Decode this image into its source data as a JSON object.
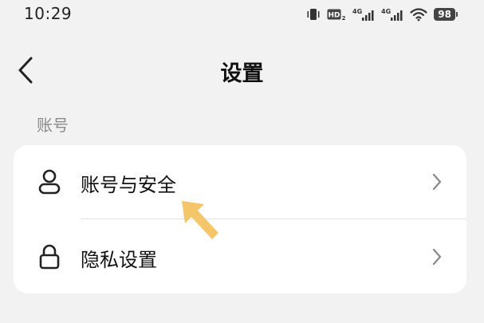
{
  "status_bar": {
    "time": "10:29",
    "battery": "98",
    "network_1": "4G",
    "network_2": "4G",
    "hd": "HD"
  },
  "header": {
    "title": "设置"
  },
  "section": {
    "label": "账号"
  },
  "settings": {
    "items": [
      {
        "label": "账号与安全",
        "icon": "user-icon"
      },
      {
        "label": "隐私设置",
        "icon": "lock-icon"
      }
    ]
  },
  "annotation": {
    "arrow_color": "#f5c56a"
  }
}
